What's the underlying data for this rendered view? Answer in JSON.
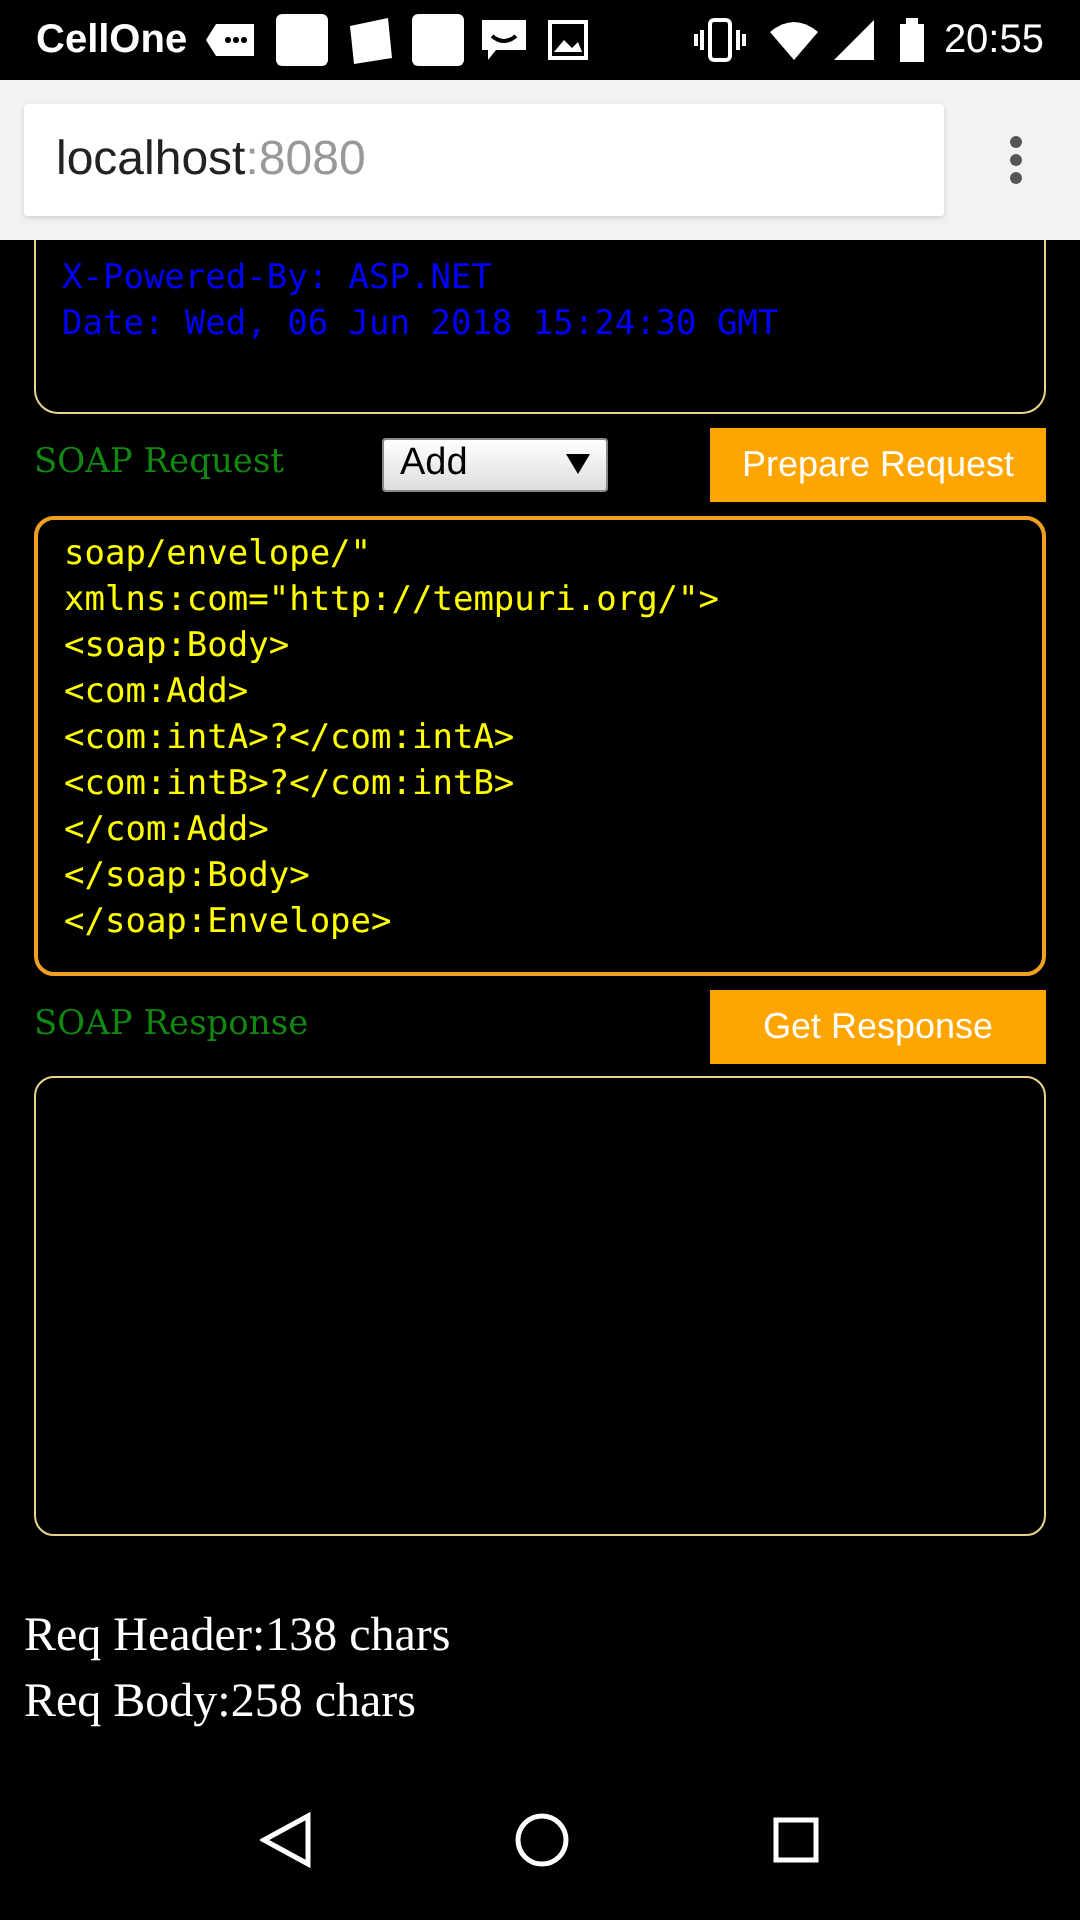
{
  "status_bar": {
    "carrier": "CellOne",
    "time": "20:55"
  },
  "browser": {
    "host": "localhost",
    "port": ":8080"
  },
  "header_box": {
    "lines": [
      "X-Powered-By: ASP.NET",
      "Date: Wed, 06 Jun 2018 15:24:30 GMT"
    ]
  },
  "request": {
    "label": "SOAP Request",
    "operation": "Add",
    "button": "Prepare Request",
    "lines": [
      "soap/envelope/\"",
      "xmlns:com=\"http://tempuri.org/\">",
      "<soap:Body>",
      "<com:Add>",
      "<com:intA>?</com:intA>",
      "<com:intB>?</com:intB>",
      "</com:Add>",
      "</soap:Body>",
      "</soap:Envelope>"
    ]
  },
  "response": {
    "label": "SOAP Response",
    "button": "Get Response"
  },
  "stats": [
    "Req Header:138 chars",
    "Req Body:258 chars"
  ]
}
